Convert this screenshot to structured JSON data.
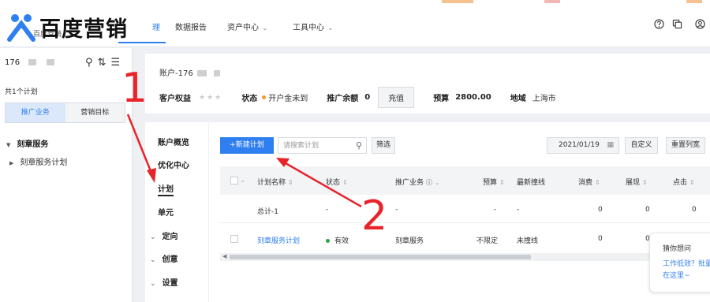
{
  "brand": {
    "logo_text": "百度营销",
    "under_text": "百度营销"
  },
  "colors": {
    "accent": "#2f7ff0",
    "annotation_red": "#e8232a",
    "status_orange": "#f59a23",
    "status_green": "#2aa34a"
  },
  "nav": {
    "tabs": [
      {
        "label": "理",
        "active": true
      },
      {
        "label": "数据报告",
        "active": false
      },
      {
        "label": "资产中心",
        "active": false,
        "chevron": "⌄"
      },
      {
        "label": "工具中心",
        "active": false,
        "chevron": "⌄"
      }
    ],
    "icons": [
      "help-icon",
      "copy-icon",
      "user-icon"
    ]
  },
  "sidebar": {
    "account_prefix": "176",
    "plan_count": "共1个计划",
    "segments": [
      "推广业务",
      "营销目标"
    ],
    "tree_group": "刻章服务",
    "tree_item": "刻章服务计划"
  },
  "account": {
    "title_prefix": "账户-176",
    "rights_label": "客户权益",
    "stars": "★★★",
    "status_label": "状态",
    "status_value": "开户金未到",
    "balance_label": "推广余额",
    "balance_value": "0",
    "recharge_label": "充值",
    "budget_label": "预算",
    "budget_value": "2800.00",
    "region_label": "地域",
    "region_value": "上海市"
  },
  "menu": {
    "items": [
      "账户概览",
      "优化中心",
      "计划",
      "单元"
    ],
    "expandable": [
      "定向",
      "创意",
      "设置"
    ]
  },
  "toolbar": {
    "new_plan": "+新建计划",
    "search_placeholder": "请搜索计划",
    "filter": "筛选",
    "date": "2021/01/19",
    "custom": "自定义",
    "reset_columns": "重置列宽"
  },
  "table": {
    "headers": [
      "计划名称",
      "状态",
      "推广业务",
      "预算",
      "最新撞线",
      "消费",
      "展现",
      "点击"
    ],
    "total_row": {
      "name": "总计-1",
      "status": "-",
      "business": "-",
      "budget": "-",
      "latest": "-",
      "spend": "0",
      "impressions": "0",
      "clicks": "0"
    },
    "rows": [
      {
        "name": "刻章服务计划",
        "status": "有效",
        "business": "刻章服务",
        "budget": "不限定",
        "latest": "未撞线",
        "spend": "0",
        "impressions": "0"
      }
    ]
  },
  "tip": {
    "title": "猜你想问",
    "line1": "工作低效？批量",
    "line2": "在这里~"
  },
  "annotations": {
    "label1": "1",
    "label2": "2"
  }
}
